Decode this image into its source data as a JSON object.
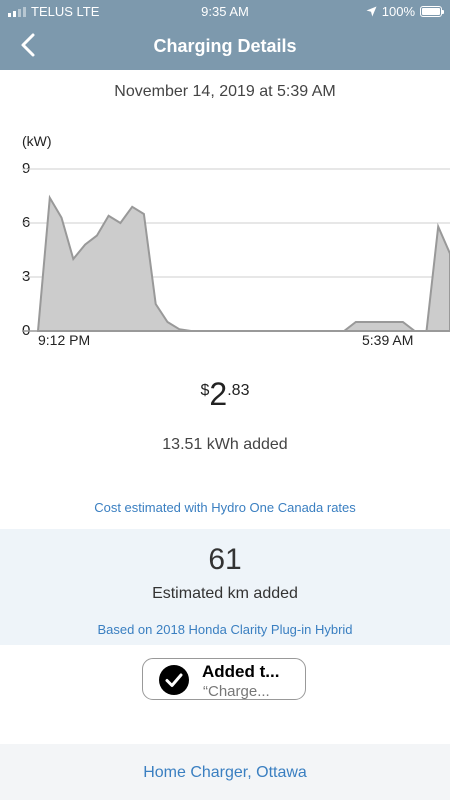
{
  "status_bar": {
    "carrier": "TELUS LTE",
    "time": "9:35 AM",
    "battery": "100%"
  },
  "header": {
    "title": "Charging Details"
  },
  "session": {
    "datetime": "November 14, 2019 at 5:39 AM"
  },
  "chart_data": {
    "type": "area",
    "ylabel": "(kW)",
    "ylim": [
      0,
      9
    ],
    "yticks": [
      "9",
      "6",
      "3",
      "0"
    ],
    "xtick_labels": [
      "9:12 PM",
      "5:39 AM"
    ],
    "x_range": [
      "9:12 PM",
      "5:39 AM"
    ],
    "grid": true,
    "color": "#cccccc",
    "stroke": "#999999",
    "series": [
      {
        "values": [
          0,
          7.4,
          6.3,
          4.0,
          4.8,
          5.3,
          6.4,
          6.0,
          6.9,
          6.5,
          1.5,
          0.5,
          0.1,
          0,
          0,
          0,
          0,
          0,
          0,
          0,
          0,
          0,
          0,
          0,
          0,
          0,
          0,
          0.5,
          0.5,
          0.5,
          0.5,
          0.5,
          0,
          0,
          5.8,
          4.3
        ]
      }
    ]
  },
  "cost": {
    "currency": "$",
    "dollars": "2",
    "cents": ".83"
  },
  "energy": {
    "added": "13.51 kWh added"
  },
  "rates_note": "Cost estimated with Hydro One Canada rates",
  "range": {
    "km": "61",
    "label": "Estimated km added",
    "vehicle": "Based on 2018 Honda Clarity Plug-in Hybrid"
  },
  "toast": {
    "title": "Added t...",
    "subtitle": "“Charge..."
  },
  "location": "Home Charger, Ottawa",
  "colors": {
    "header": "#7d99ad",
    "link": "#3a7fc1",
    "panel": "#eef4f9"
  }
}
